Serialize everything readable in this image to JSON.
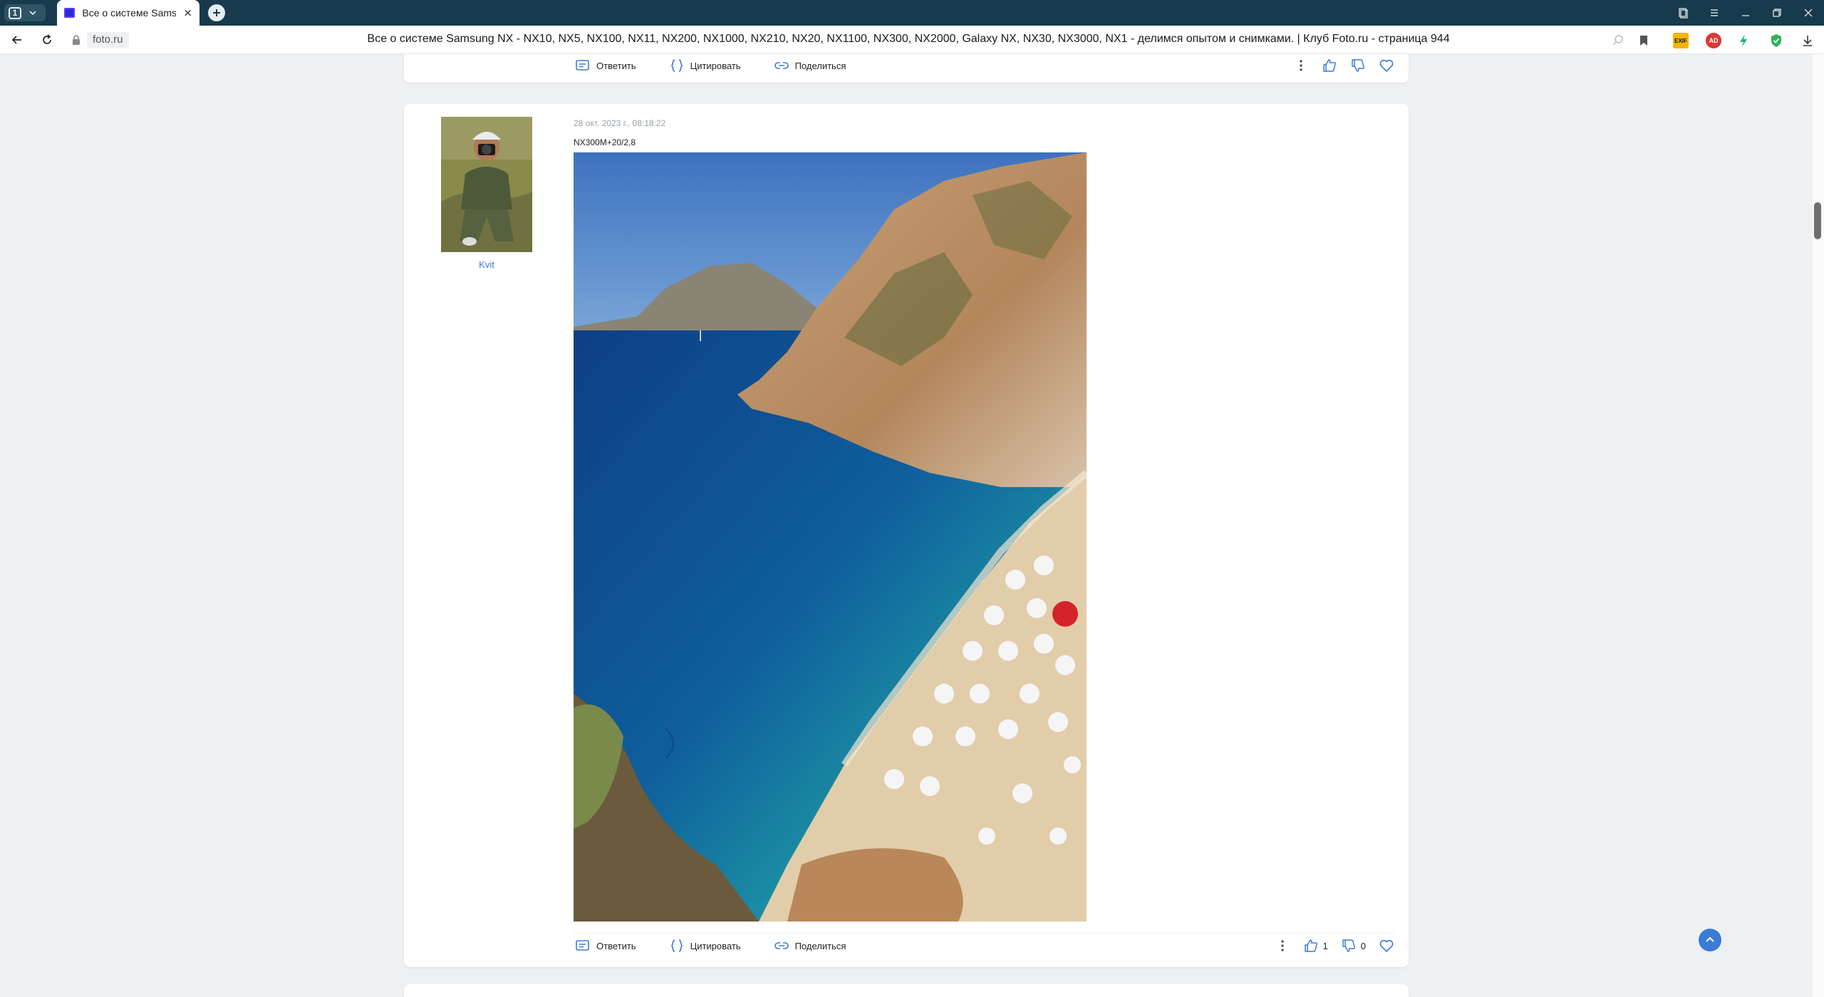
{
  "browser": {
    "tab_count": "1",
    "tab_title": "Все о системе Samsung NX - NX10, NX5, NX100...",
    "domain": "foto.ru",
    "page_title": "Все о системе Samsung NX - NX10, NX5, NX100, NX11, NX200, NX1000, NX210, NX20, NX1100, NX300, NX2000, Galaxy NX, NX30, NX3000, NX1 - делимся опытом и снимками. | Клуб Foto.ru - страница 944",
    "extensions": {
      "exif_label": "EXIF",
      "ad_label": "AD"
    }
  },
  "actions": {
    "reply": "Ответить",
    "quote": "Цитировать",
    "share": "Поделиться"
  },
  "post": {
    "author": "Kvit",
    "time": "28 окт. 2023 г., 08:18:22",
    "text": "NX300M+20/2,8",
    "likes": "1",
    "dislikes": "0"
  },
  "colors": {
    "accent": "#3a7bd5",
    "tabbar": "#173a4c"
  }
}
